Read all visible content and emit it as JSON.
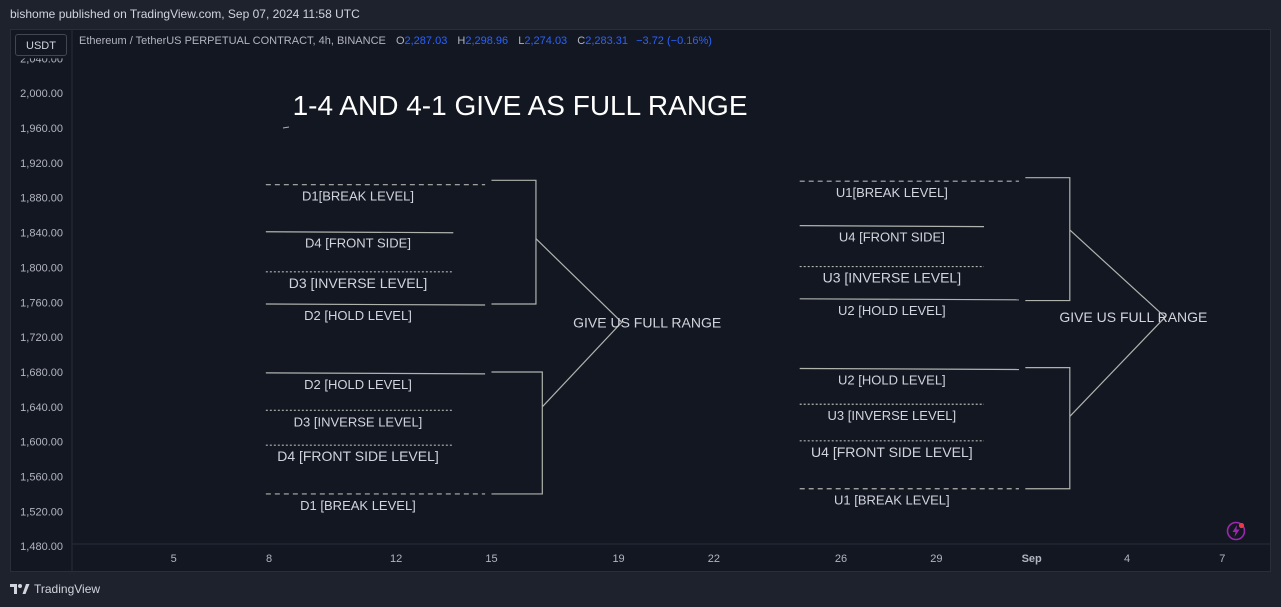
{
  "header": {
    "published_by": "bishome published on TradingView.com, Sep 07, 2024 11:58 UTC"
  },
  "toolbar": {
    "currency": "USDT"
  },
  "legend": {
    "symbol": "Ethereum / TetherUS PERPETUAL CONTRACT, 4h, BINANCE",
    "open_label": "O",
    "open": "2,287.03",
    "high_label": "H",
    "high": "2,298.96",
    "low_label": "L",
    "low": "2,274.03",
    "close_label": "C",
    "close": "2,283.31",
    "change": "−3.72 (−0.16%)"
  },
  "footer": {
    "brand": "TradingView"
  },
  "colors": {
    "background": "#131722",
    "text": "#d1d4dc",
    "axis_text": "#b2b5be",
    "legend_value": "#2962ff",
    "drawing": "#b0b3ad"
  },
  "chart_data": {
    "type": "line",
    "title": "1-4 AND 4-1 GIVE AS FULL RANGE",
    "y_ticks": [
      "2,000.00",
      "1,960.00",
      "1,920.00",
      "1,880.00",
      "1,840.00",
      "1,800.00",
      "1,760.00",
      "1,720.00",
      "1,680.00",
      "1,640.00",
      "1,600.00",
      "1,560.00",
      "1,520.00",
      "1,480.00"
    ],
    "y_cut_tick": "2,040.00",
    "y_values": [
      2000,
      1960,
      1920,
      1880,
      1840,
      1800,
      1760,
      1720,
      1680,
      1640,
      1600,
      1560,
      1520,
      1480
    ],
    "ylim": [
      1455,
      2045
    ],
    "x_ticks": [
      "5",
      "8",
      "12",
      "15",
      "19",
      "22",
      "26",
      "29",
      "Sep",
      "4",
      "7"
    ],
    "x_tick_days": [
      5,
      8,
      12,
      15,
      19,
      22,
      26,
      29,
      32,
      35,
      38
    ],
    "xlim": [
      1.8,
      39.5
    ],
    "groups": [
      {
        "levels": [
          {
            "label": "D1[BREAK LEVEL]",
            "price": 1895,
            "style": "dashed",
            "x0": 7.9,
            "x1": 14.8
          },
          {
            "label": "D4 [FRONT SIDE]",
            "price": 1841,
            "style": "solid",
            "x0": 7.9,
            "x1": 13.8
          },
          {
            "label": "D3 [INVERSE LEVEL]",
            "price": 1795,
            "style": "dotted",
            "x0": 7.9,
            "x1": 13.8
          },
          {
            "label": "D2 [HOLD LEVEL]",
            "price": 1758,
            "style": "solid",
            "x0": 7.9,
            "x1": 14.8
          }
        ]
      },
      {
        "levels": [
          {
            "label": "D2  [HOLD LEVEL]",
            "price": 1679,
            "style": "solid",
            "x0": 7.9,
            "x1": 14.8
          },
          {
            "label": "D3 [INVERSE LEVEL]",
            "price": 1636,
            "style": "dotted",
            "x0": 7.9,
            "x1": 13.8
          },
          {
            "label": "D4  [FRONT SIDE LEVEL]",
            "price": 1596,
            "style": "dotted",
            "x0": 7.9,
            "x1": 13.8
          },
          {
            "label": "D1 [BREAK LEVEL]",
            "price": 1540,
            "style": "dashed",
            "x0": 7.9,
            "x1": 14.8
          }
        ]
      },
      {
        "levels": [
          {
            "label": "U1[BREAK LEVEL]",
            "price": 1899,
            "style": "dashed",
            "x0": 24.7,
            "x1": 31.6
          },
          {
            "label": "U4 [FRONT SIDE]",
            "price": 1848,
            "style": "solid",
            "x0": 24.7,
            "x1": 30.5
          },
          {
            "label": "U3  [INVERSE LEVEL]",
            "price": 1801,
            "style": "dotted",
            "x0": 24.7,
            "x1": 30.5
          },
          {
            "label": "U2 [HOLD LEVEL]",
            "price": 1764,
            "style": "solid",
            "x0": 24.7,
            "x1": 31.6
          }
        ]
      },
      {
        "levels": [
          {
            "label": "U2  [HOLD LEVEL]",
            "price": 1684,
            "style": "solid",
            "x0": 24.7,
            "x1": 31.6
          },
          {
            "label": "U3 [INVERSE LEVEL]",
            "price": 1643,
            "style": "dotted",
            "x0": 24.7,
            "x1": 30.5
          },
          {
            "label": "U4  [FRONT SIDE LEVEL]",
            "price": 1601,
            "style": "dotted",
            "x0": 24.7,
            "x1": 30.5
          },
          {
            "label": "U1 [BREAK LEVEL]",
            "price": 1546,
            "style": "dashed",
            "x0": 24.7,
            "x1": 31.6
          }
        ]
      }
    ],
    "annotations": [
      {
        "text": "GIVE US FULL RANGE",
        "x": 19.9,
        "price": 1737
      },
      {
        "text": "GIVE US FULL RANGE",
        "x": 35.2,
        "price": 1743
      }
    ]
  }
}
